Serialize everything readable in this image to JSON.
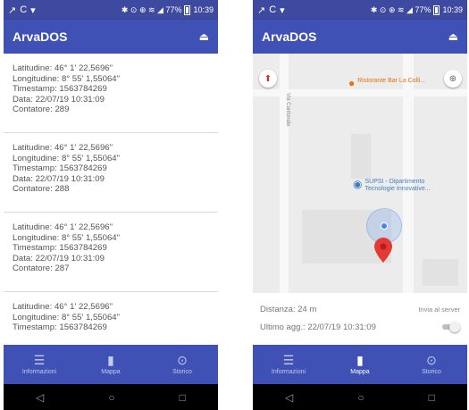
{
  "status": {
    "left_icons": [
      "↗",
      "C",
      "▾"
    ],
    "right_text": "✱ ⊙ ⊕ ≋ ◢ 77%",
    "time": "10:39"
  },
  "app": {
    "title": "ArvaDOS",
    "eject_icon": "⏏"
  },
  "records": [
    {
      "lat": "Latitudine: 46° 1' 22,5696\"",
      "lon": "Longitudine: 8° 55' 1,55064\"",
      "ts": "Timestamp: 1563784269",
      "date": "Data: 22/07/19 10:31:09",
      "counter": "Contatore: 289"
    },
    {
      "lat": "Latitudine: 46° 1' 22,5696\"",
      "lon": "Longitudine: 8° 55' 1,55064\"",
      "ts": "Timestamp: 1563784269",
      "date": "Data: 22/07/19 10:31:09",
      "counter": "Contatore: 288"
    },
    {
      "lat": "Latitudine: 46° 1' 22,5696\"",
      "lon": "Longitudine: 8° 55' 1,55064\"",
      "ts": "Timestamp: 1563784269",
      "date": "Data: 22/07/19 10:31:09",
      "counter": "Contatore: 287"
    },
    {
      "lat": "Latitudine: 46° 1' 22,5696\"",
      "lon": "Longitudine: 8° 55' 1,55064\"",
      "ts": "Timestamp: 1563784269",
      "date": "",
      "counter": ""
    }
  ],
  "nav": {
    "items": [
      {
        "label": "Informazioni",
        "icon": "☰"
      },
      {
        "label": "Mappa",
        "icon": "▮"
      },
      {
        "label": "Storico",
        "icon": "⊙"
      }
    ],
    "active_index": 1
  },
  "sysnav": {
    "back": "◁",
    "home": "○",
    "recents": "□"
  },
  "map": {
    "poi_restaurant": "Ristorante Bar La Colli...",
    "poi_supsi_line1": "SUPSI - Dipartimento",
    "poi_supsi_line2": "Tecnologie Innovative...",
    "street_label": "Via Cantonale",
    "compass_icon": "⬆",
    "locate_icon": "⊕",
    "distance": "Distanza: 24 m",
    "send_label": "Invia al server",
    "last_update": "Ultimo agg.: 22/07/19 10:31:09",
    "toggle_on": false
  }
}
